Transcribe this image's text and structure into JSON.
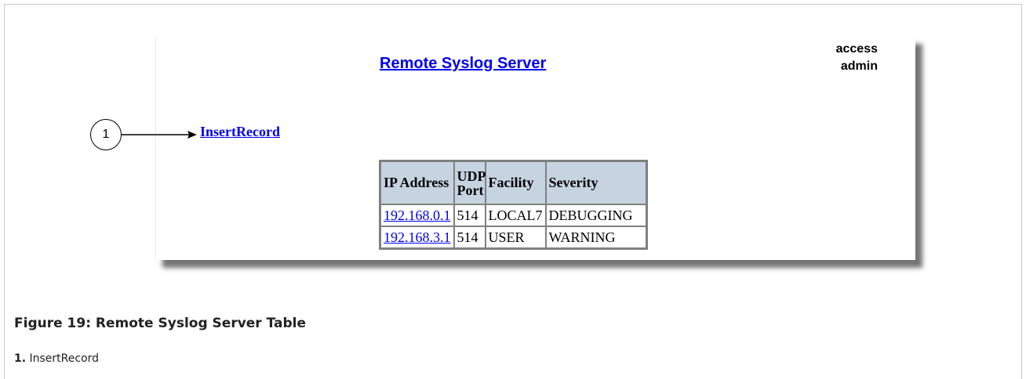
{
  "header": {
    "title": "Remote Syslog Server",
    "access_label": "access",
    "access_value": "admin"
  },
  "actions": {
    "insert_record": "InsertRecord"
  },
  "table": {
    "columns": [
      "IP Address",
      "UDP Port",
      "Facility",
      "Severity"
    ],
    "rows": [
      [
        "192.168.0.1",
        "514",
        "LOCAL7",
        "DEBUGGING"
      ],
      [
        "192.168.3.1",
        "514",
        "USER",
        "WARNING"
      ]
    ]
  },
  "callout": {
    "number": "1"
  },
  "figure": {
    "caption": "Figure 19: Remote Syslog Server Table",
    "legend_number": "1.",
    "legend_text": "InsertRecord"
  },
  "colors": {
    "link": "#0000ee",
    "table_header_bg": "#c6d3e0"
  }
}
